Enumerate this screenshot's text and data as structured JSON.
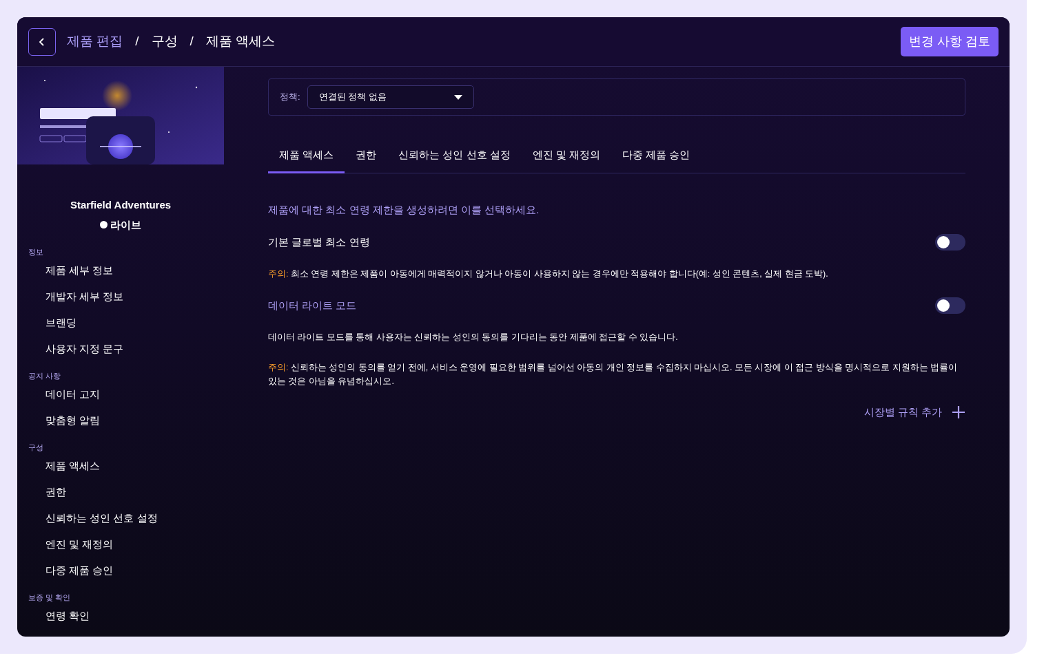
{
  "header": {
    "breadcrumb": [
      {
        "label": "제품 편집",
        "kind": "link"
      },
      {
        "label": "/",
        "kind": "separator"
      },
      {
        "label": "구성",
        "kind": "current"
      },
      {
        "label": "/",
        "kind": "separator"
      },
      {
        "label": "제품 액세스",
        "kind": "current"
      }
    ],
    "review_button": "변경 사항 검토"
  },
  "sidebar": {
    "product_name": "Starfield Adventures",
    "status": "라이브",
    "sections": [
      {
        "heading": "정보",
        "items": [
          {
            "label": "제품 세부 정보"
          },
          {
            "label": "개발자 세부 정보"
          },
          {
            "label": "브랜딩"
          },
          {
            "label": "사용자 지정 문구"
          }
        ]
      },
      {
        "heading": "공지 사항",
        "items": [
          {
            "label": "데이터 고지"
          },
          {
            "label": "맞춤형 알림"
          }
        ]
      },
      {
        "heading": "구성",
        "items": [
          {
            "label": "제품 액세스"
          },
          {
            "label": "권한"
          },
          {
            "label": "신뢰하는 성인 선호 설정"
          },
          {
            "label": "엔진 및 재정의"
          },
          {
            "label": "다중 제품 승인"
          }
        ]
      },
      {
        "heading": "보증 및 확인",
        "items": [
          {
            "label": "연령 확인"
          }
        ]
      }
    ]
  },
  "policy": {
    "label": "정책:",
    "value": "연결된 정책 없음"
  },
  "tabs": [
    {
      "label": "제품 액세스",
      "selected": true
    },
    {
      "label": "권한",
      "selected": false
    },
    {
      "label": "신뢰하는 성인 선호 설정",
      "selected": false
    },
    {
      "label": "엔진 및 재정의",
      "selected": false
    },
    {
      "label": "다중 제품 승인",
      "selected": false
    }
  ],
  "blocks": [
    {
      "kind": "heading",
      "text": "제품에 대한 최소 연령 제한을 생성하려면 이를 선택하세요."
    },
    {
      "kind": "toggle",
      "label": "기본 글로벌 최소 연령",
      "on": false,
      "accent": false
    },
    {
      "kind": "note",
      "prefix": "주의:",
      "text": "최소 연령 제한은 제품이 아동에게 매력적이지 않거나 아동이 사용하지 않는 경우에만 적용해야 합니다(예: 성인 콘텐츠, 실제 현금 도박)."
    },
    {
      "kind": "toggle",
      "label": "데이터 라이트 모드",
      "on": false,
      "accent": true
    },
    {
      "kind": "paragraph",
      "text": "데이터 라이트 모드를 통해 사용자는 신뢰하는 성인의 동의를 기다리는 동안 제품에 접근할 수 있습니다."
    },
    {
      "kind": "note",
      "prefix": "주의:",
      "text": "신뢰하는 성인의 동의를 얻기 전에, 서비스 운영에 필요한 범위를 넘어선 아동의 개인 정보를 수집하지 마십시오. 모든 시장에 이 접근 방식을 명시적으로 지원하는 법률이 있는 것은 아님을 유념하십시오."
    }
  ],
  "add_rule": "시장별 규칙 추가"
}
